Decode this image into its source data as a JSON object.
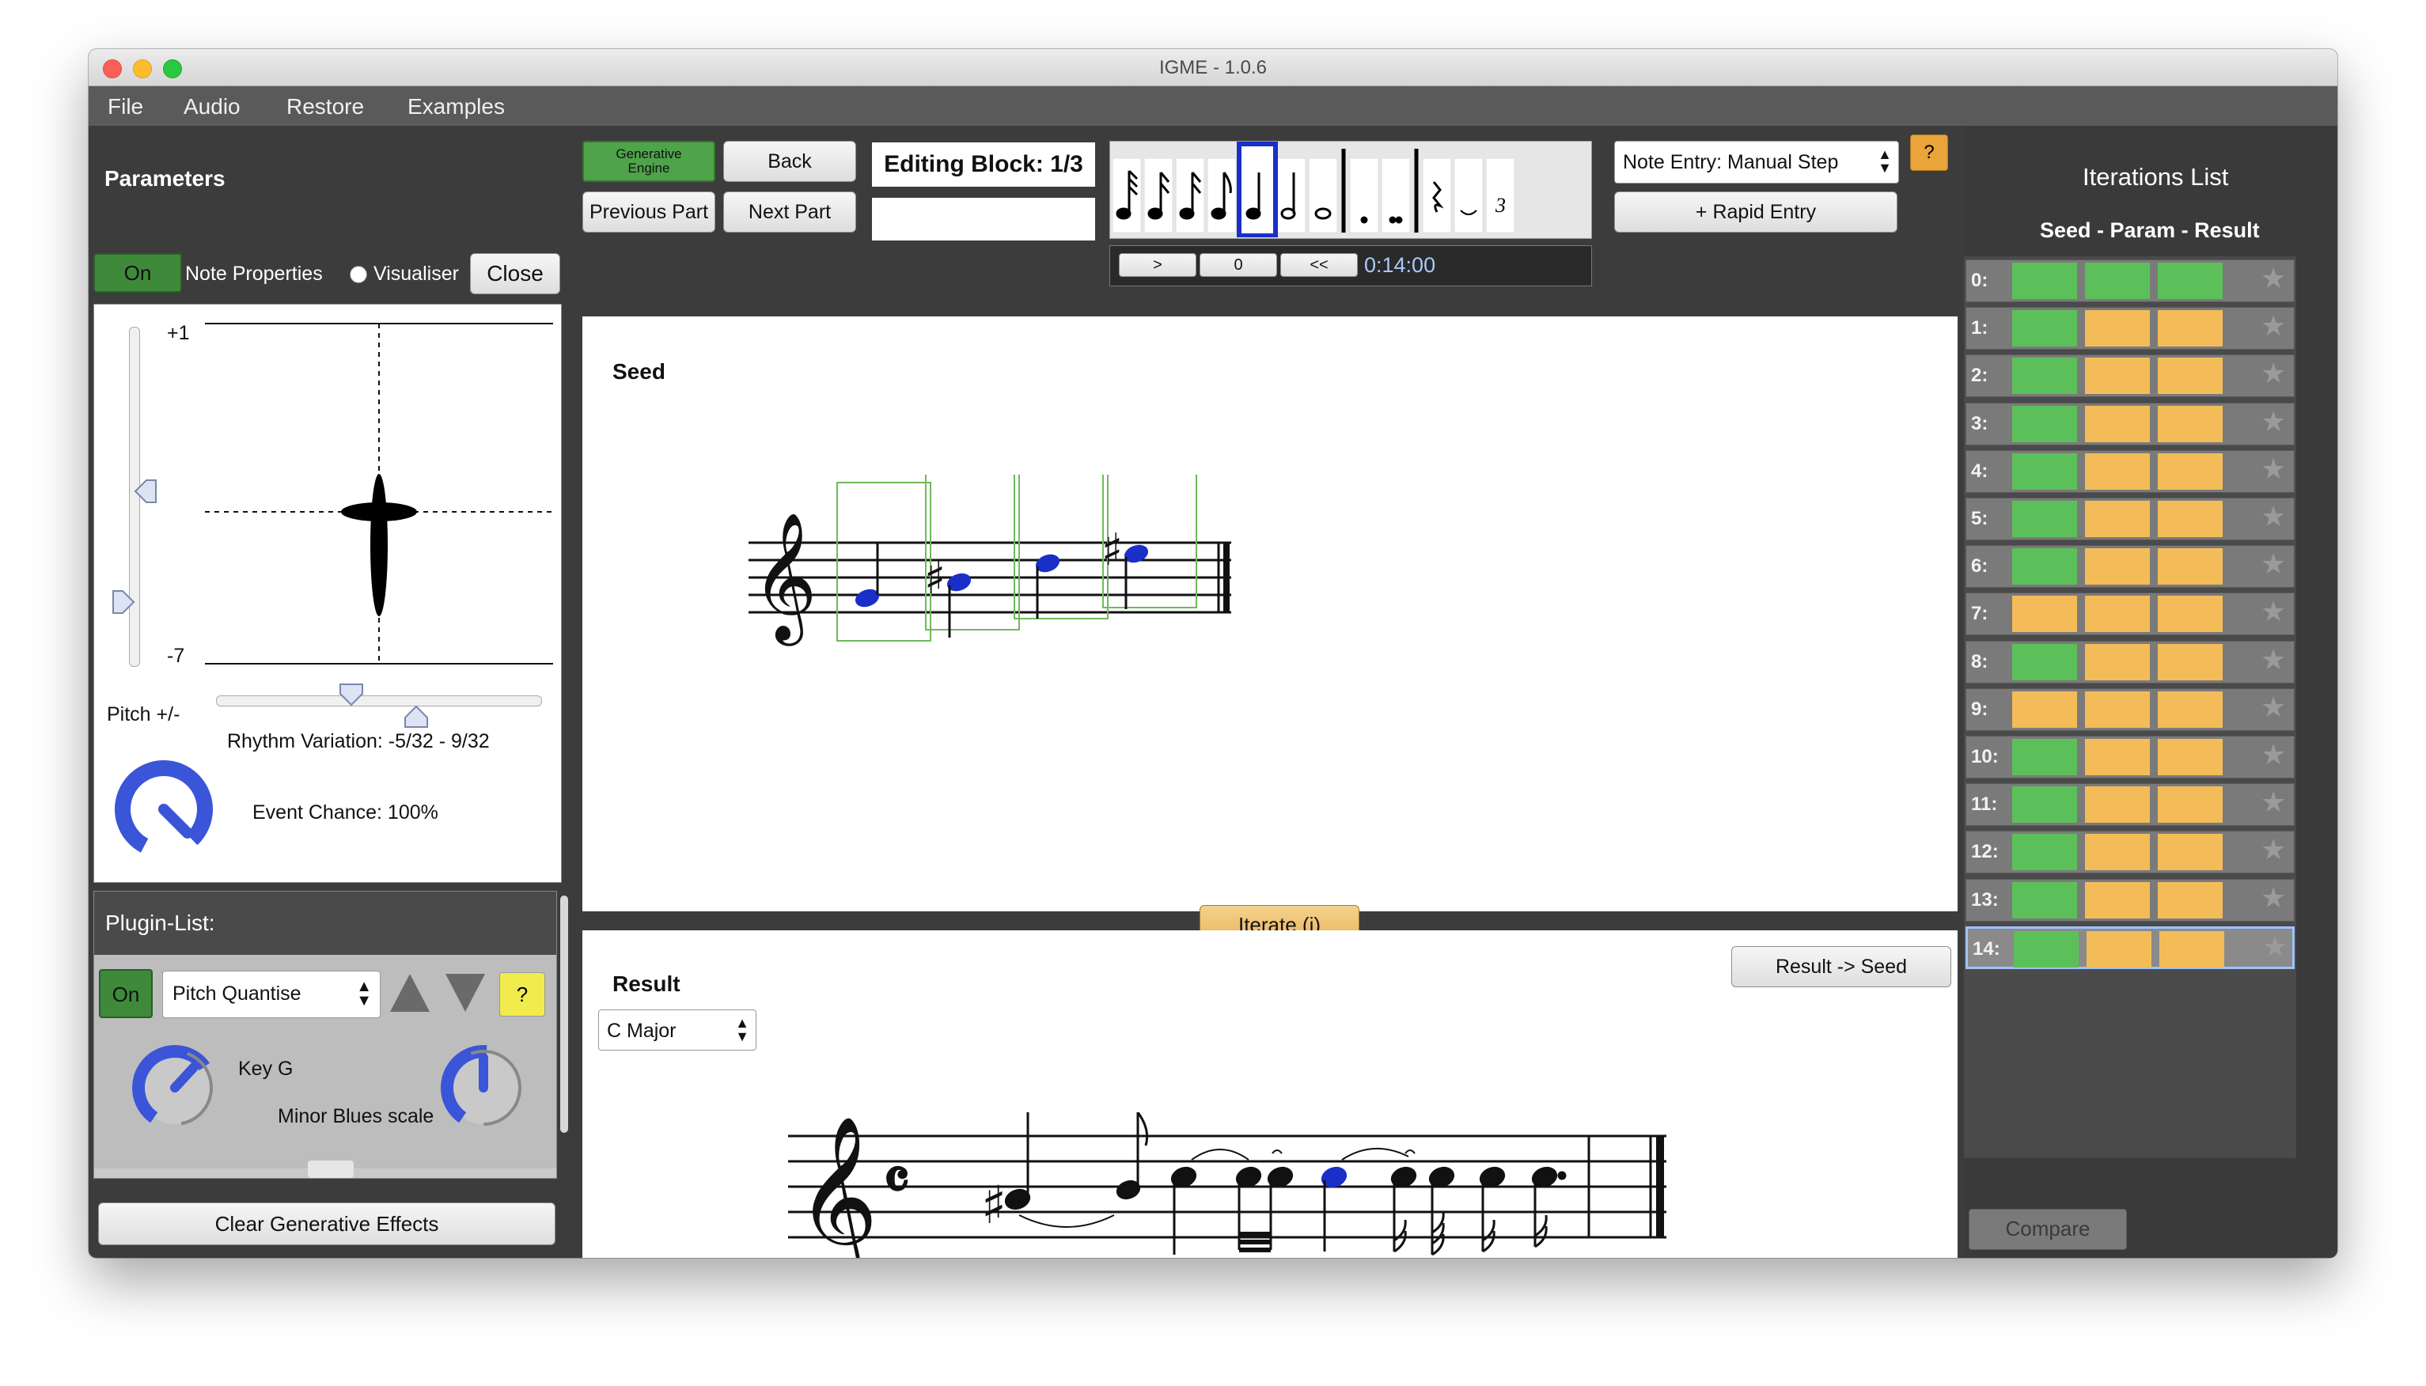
{
  "window": {
    "title": "IGME - 1.0.6"
  },
  "menu": [
    "File",
    "Audio",
    "Restore",
    "Examples"
  ],
  "toolbar": {
    "generative_engine": "Generative Engine",
    "back": "Back",
    "previous_part": "Previous Part",
    "next_part": "Next Part",
    "editing_block": "Editing Block: 1/3",
    "playback_buttons": [
      ">",
      "0",
      "<<"
    ],
    "time": "0:14:00",
    "note_entry_mode": "Note Entry: Manual Step",
    "rapid_entry": "+ Rapid Entry",
    "help": "?",
    "tuplet": "3"
  },
  "parameters": {
    "title": "Parameters",
    "on": "On",
    "note_properties": "Note Properties",
    "visualiser": "Visualiser",
    "close": "Close",
    "plus_label": "+1",
    "minus_label": "-7",
    "pitch_label": "Pitch +/-",
    "rhythm_variation": "Rhythm Variation: -5/32 - 9/32",
    "event_chance": "Event Chance: 100%"
  },
  "plugin_list": {
    "title": "Plugin-List:",
    "on": "On",
    "plugin": "Pitch Quantise",
    "help": "?",
    "key": "Key G",
    "scale": "Minor Blues scale",
    "clear": "Clear Generative Effects"
  },
  "seed": {
    "title": "Seed"
  },
  "iterate": "Iterate (i)",
  "result": {
    "title": "Result",
    "key_select": "C Major",
    "result_to_seed": "Result -> Seed"
  },
  "iterations": {
    "title": "Iterations List",
    "subtitle": "Seed - Param - Result",
    "compare": "Compare",
    "rows": [
      {
        "label": "0:",
        "seed": "green",
        "param": "green",
        "result": "green"
      },
      {
        "label": "1:",
        "seed": "green",
        "param": "orange",
        "result": "orange"
      },
      {
        "label": "2:",
        "seed": "green",
        "param": "orange",
        "result": "orange"
      },
      {
        "label": "3:",
        "seed": "green",
        "param": "orange",
        "result": "orange"
      },
      {
        "label": "4:",
        "seed": "green",
        "param": "orange",
        "result": "orange"
      },
      {
        "label": "5:",
        "seed": "green",
        "param": "orange",
        "result": "orange"
      },
      {
        "label": "6:",
        "seed": "green",
        "param": "orange",
        "result": "orange"
      },
      {
        "label": "7:",
        "seed": "orange",
        "param": "orange",
        "result": "orange"
      },
      {
        "label": "8:",
        "seed": "green",
        "param": "orange",
        "result": "orange"
      },
      {
        "label": "9:",
        "seed": "orange",
        "param": "orange",
        "result": "orange"
      },
      {
        "label": "10:",
        "seed": "green",
        "param": "orange",
        "result": "orange"
      },
      {
        "label": "11:",
        "seed": "green",
        "param": "orange",
        "result": "orange"
      },
      {
        "label": "12:",
        "seed": "green",
        "param": "orange",
        "result": "orange"
      },
      {
        "label": "13:",
        "seed": "green",
        "param": "orange",
        "result": "orange"
      },
      {
        "label": "14:",
        "seed": "green",
        "param": "orange",
        "result": "orange"
      }
    ]
  },
  "colors": {
    "green": "#5cc05a",
    "orange": "#f4bc58",
    "note_blue": "#1a2fc8",
    "accent_green": "#3f8a3a"
  }
}
